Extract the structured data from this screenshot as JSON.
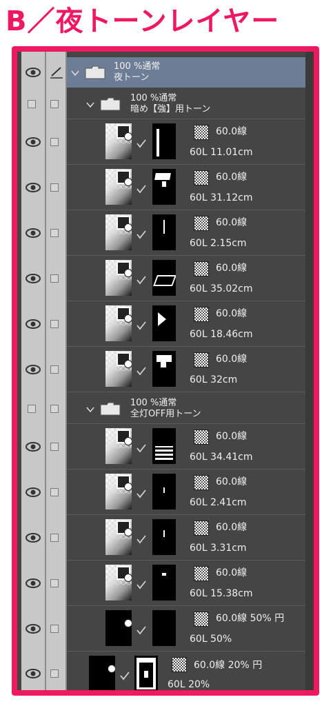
{
  "title": "B／夜トーンレイヤー",
  "colors": {
    "accent": "#f0195f",
    "panel": "#454545",
    "selected": "#6e7d96"
  },
  "top_group": {
    "blend": "100 %通常",
    "name": "夜トーン"
  },
  "group1": {
    "blend": "100 %通常",
    "name": "暗め【強】用トーン"
  },
  "group1_layers": [
    {
      "line": "60.0線",
      "info": "60L 11.01cm"
    },
    {
      "line": "60.0線",
      "info": "60L 31.12cm"
    },
    {
      "line": "60.0線",
      "info": "60L 2.15cm"
    },
    {
      "line": "60.0線",
      "info": "60L 35.02cm"
    },
    {
      "line": "60.0線",
      "info": "60L 18.46cm"
    },
    {
      "line": "60.0線",
      "info": "60L 32cm"
    }
  ],
  "group2": {
    "blend": "100 %通常",
    "name": "全灯OFF用トーン"
  },
  "group2_layers": [
    {
      "line": "60.0線",
      "info": "60L 34.41cm"
    },
    {
      "line": "60.0線",
      "info": "60L 2.41cm"
    },
    {
      "line": "60.0線",
      "info": "60L 3.31cm"
    },
    {
      "line": "60.0線",
      "info": "60L 15.38cm"
    },
    {
      "line": "60.0線 50% 円",
      "info": "60L 50%"
    }
  ],
  "last_layer": {
    "line": "60.0線 20% 円",
    "info": "60L 20%"
  },
  "icons": {
    "visibility": "eye-icon",
    "edit": "pencil-icon",
    "expand": "chevron-down-icon",
    "group": "folder-icon",
    "tone": "tone-pattern-icon",
    "linked": "check-icon"
  }
}
